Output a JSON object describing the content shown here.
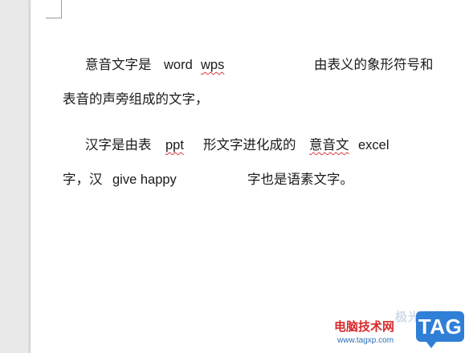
{
  "document": {
    "p1": {
      "l1_a": "意音文字是",
      "l1_b": "word",
      "l1_c": "wps",
      "l1_d": "由表义的象形符号和",
      "l2": "表音的声旁组成的文字，"
    },
    "p2": {
      "l1_a": "汉字是由表",
      "l1_b": "ppt",
      "l1_c": "形文字进化成的",
      "l1_d": "意音文",
      "l1_e": "excel",
      "l2_a": "字，汉",
      "l2_b": "give happy",
      "l2_c": "字也是语素文字。"
    }
  },
  "watermark": {
    "faint": "极光下载站",
    "title": "电脑技术网",
    "url": "www.tagxp.com",
    "badge": "TAG"
  },
  "colors": {
    "page": "#ffffff",
    "workspace": "#e9e9ea",
    "spellcheck": "#d63b3b",
    "badge": "#2f7fd6",
    "brand_red": "#d92b2b"
  }
}
